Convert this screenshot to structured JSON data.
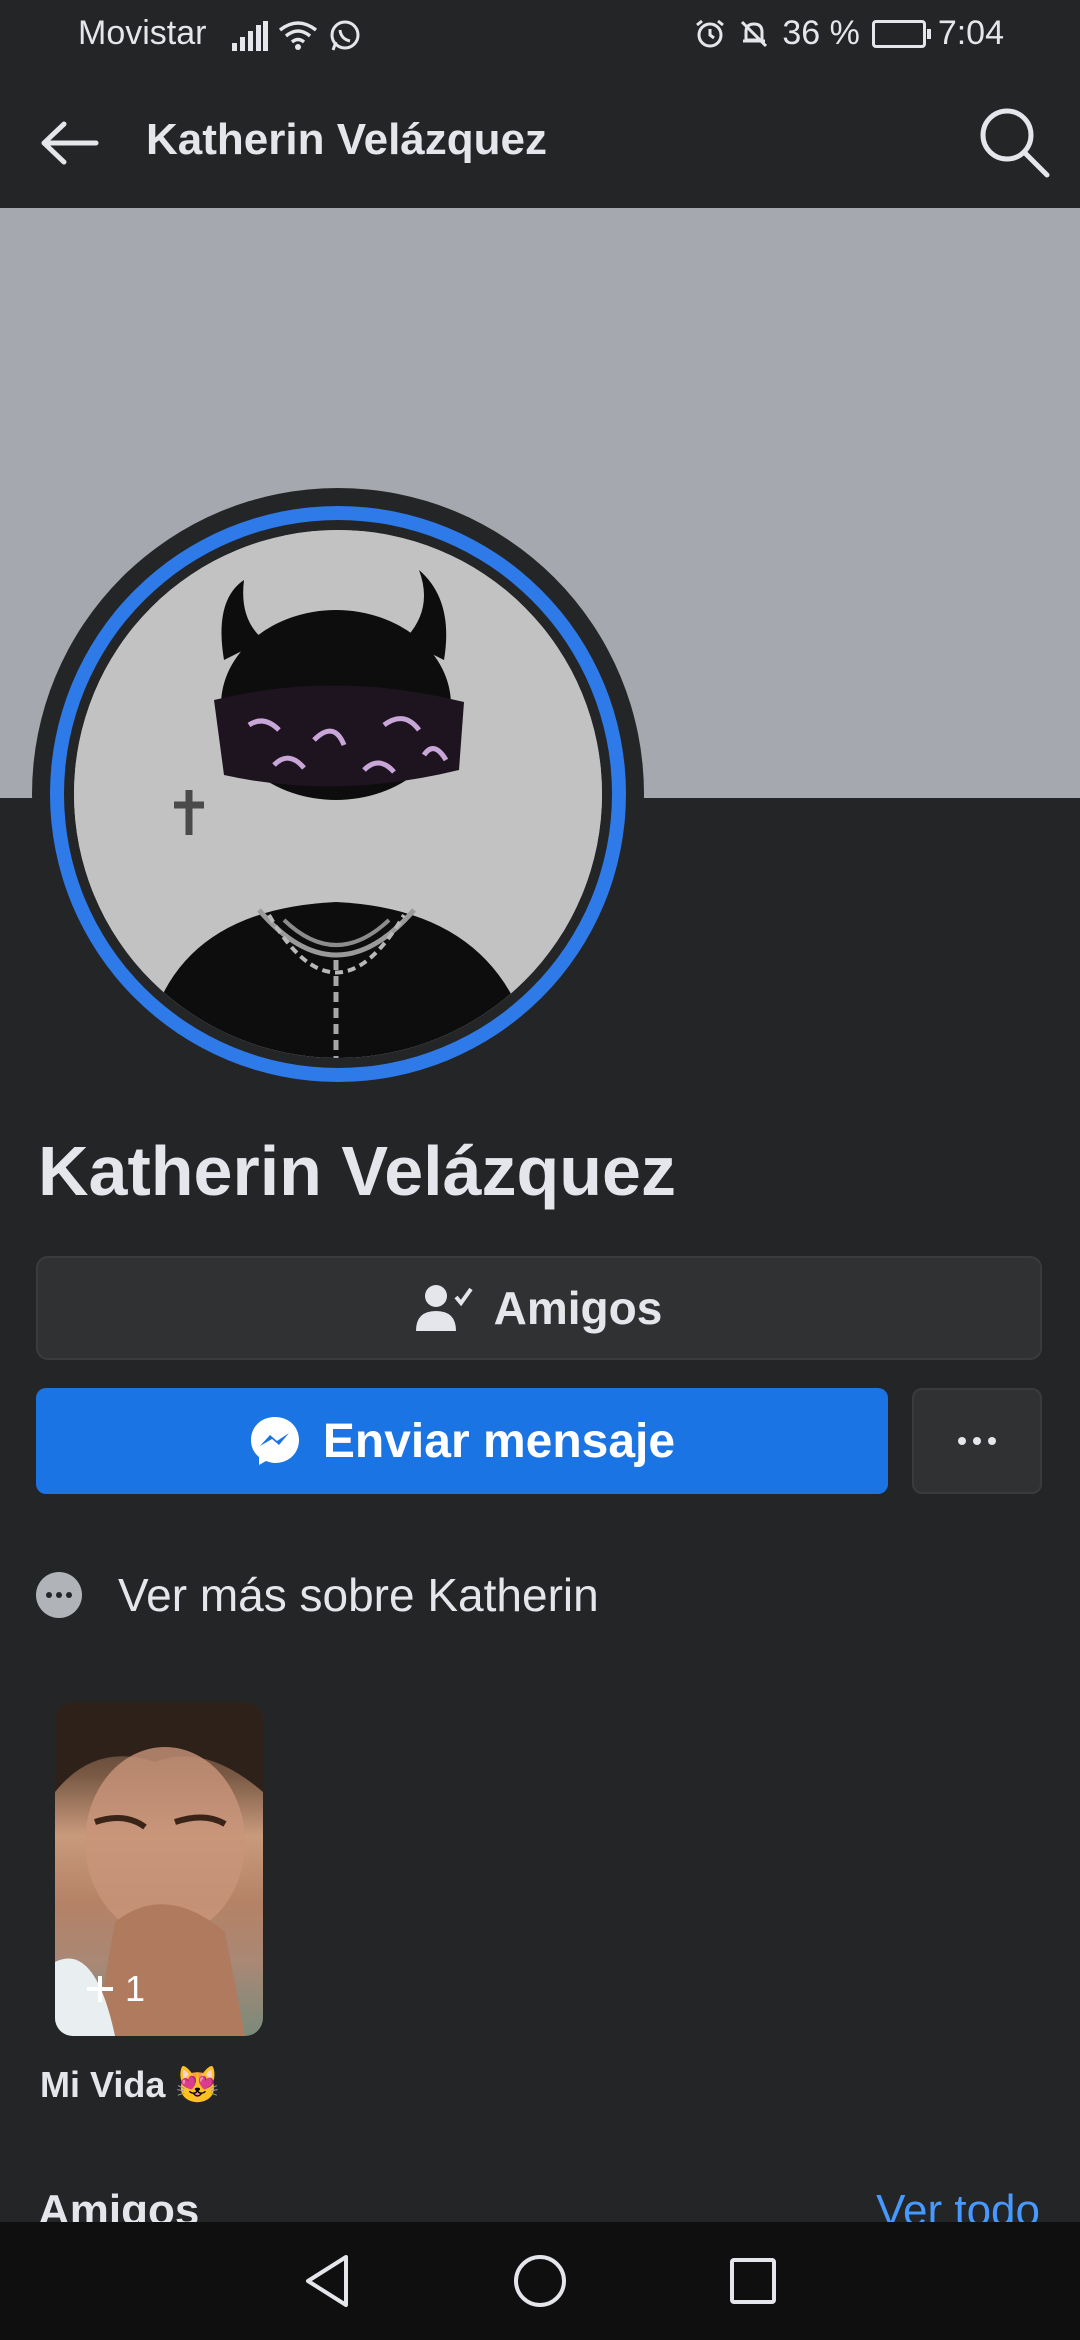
{
  "status_bar": {
    "carrier": "Movistar",
    "battery": "36 %",
    "time": "7:04"
  },
  "app_bar": {
    "title": "Katherin Velázquez",
    "back_icon": "arrow-left-icon",
    "search_icon": "search-icon"
  },
  "profile": {
    "name": "Katherin Velázquez"
  },
  "actions": {
    "friends_label": "Amigos",
    "message_label": "Enviar mensaje",
    "more_icon": "more-horizontal-icon"
  },
  "see_more": {
    "label": "Ver más sobre Katherin"
  },
  "highlight": {
    "count": "1",
    "label": "Mi Vida 😻"
  },
  "friends_section": {
    "heading": "Amigos",
    "see_all": "Ver todo"
  },
  "colors": {
    "background": "#242527",
    "cover": "#a5a8ae",
    "accent": "#1b74e4",
    "link": "#4599ff"
  }
}
